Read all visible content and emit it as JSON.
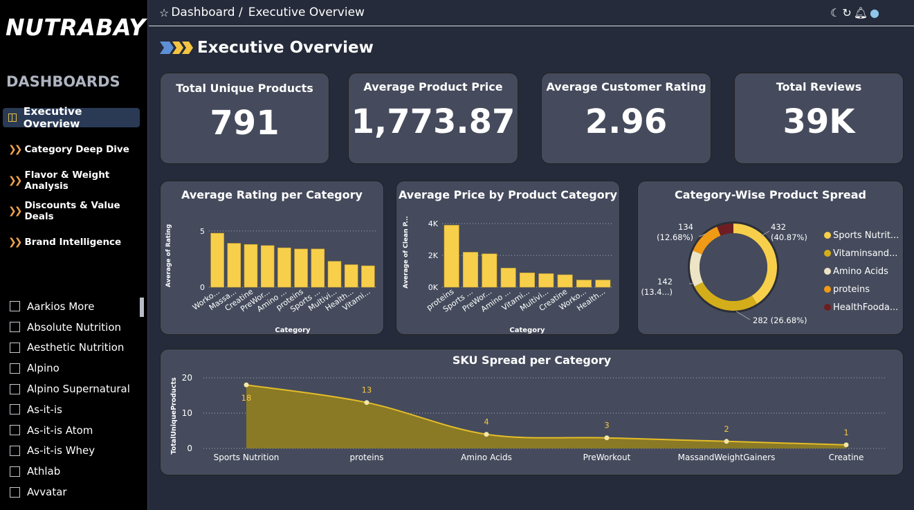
{
  "app": {
    "logo": "NUTRABAY"
  },
  "sidebar": {
    "heading": "DASHBOARDS",
    "nav": [
      {
        "label": "Executive Overview",
        "active": true
      },
      {
        "label": "Category Deep Dive"
      },
      {
        "label": "Flavor & Weight Analysis"
      },
      {
        "label": "Discounts & Value Deals"
      },
      {
        "label": "Brand Intelligence"
      }
    ],
    "brands": [
      "Aarkios More",
      "Absolute Nutrition",
      "Aesthetic Nutrition",
      "Alpino",
      "Alpino Supernatural",
      "As-it-is",
      "As-it-is Atom",
      "As-it-is Whey",
      "Athlab",
      "Avvatar"
    ]
  },
  "header": {
    "breadcrumb_root": "Dashboard /",
    "breadcrumb_current": "Executive Overview",
    "icons": [
      "moon-icon",
      "refresh-icon",
      "bell-icon",
      "globe-icon"
    ]
  },
  "page": {
    "title": "Executive Overview"
  },
  "kpis": [
    {
      "label": "Total Unique Products",
      "value": "791"
    },
    {
      "label": "Average Product Price",
      "value": "1,773.87"
    },
    {
      "label": "Average Customer Rating",
      "value": "2.96"
    },
    {
      "label": "Total Reviews",
      "value": "39K"
    }
  ],
  "colors": {
    "accent": "#f5c542",
    "panel": "#454b5c",
    "background": "#252b3a"
  },
  "chart_data": [
    {
      "type": "bar",
      "title": "Average Rating per Category",
      "xlabel": "Category",
      "ylabel": "Average of Rating",
      "categories": [
        "Worko...",
        "Massa...",
        "Creatine",
        "PreWor...",
        "Amino ...",
        "proteins",
        "Sports ...",
        "Multivi...",
        "Health...",
        "Vitami..."
      ],
      "values": [
        4.8,
        3.9,
        3.8,
        3.7,
        3.5,
        3.4,
        3.4,
        2.3,
        2.0,
        1.9
      ],
      "yticks": [
        "5",
        "0"
      ],
      "ylim": [
        0,
        5.6
      ]
    },
    {
      "type": "bar",
      "title": "Average Price by Product Category",
      "xlabel": "Category",
      "ylabel": "Average of Clean P...",
      "categories": [
        "proteins",
        "Sports ...",
        "PreWor...",
        "Amino ...",
        "Vitami...",
        "Multivi...",
        "Creatine",
        "Worko...",
        "Health..."
      ],
      "values": [
        3900,
        2200,
        2100,
        1200,
        900,
        850,
        780,
        450,
        450
      ],
      "yticks": [
        "4K",
        "2K",
        "0K"
      ],
      "ylim": [
        0,
        4400
      ]
    },
    {
      "type": "pie",
      "title": "Category-Wise Product Spread",
      "categories": [
        "Sports Nutrit...",
        "Vitaminsand...",
        "Amino Acids",
        "proteins",
        "HealthFooda..."
      ],
      "values": [
        432,
        282,
        142,
        134,
        65
      ],
      "labels": [
        {
          "count": "432",
          "pct": "(40.87%)"
        },
        {
          "count": "282 (26.68%)",
          "pct": ""
        },
        {
          "count": "142",
          "pct": "(13.4...)"
        },
        {
          "count": "134",
          "pct": "(12.68%)"
        }
      ],
      "colors": [
        "#f7cf4a",
        "#d4ad1a",
        "#ede4c6",
        "#f09a16",
        "#6e1e22"
      ]
    },
    {
      "type": "area",
      "title": "SKU Spread per Category",
      "ylabel": "TotalUniqueProducts",
      "categories": [
        "Sports Nutrition",
        "proteins",
        "Amino Acids",
        "PreWorkout",
        "MassandWeightGainers",
        "Creatine"
      ],
      "values": [
        18,
        13,
        4,
        3,
        2,
        1
      ],
      "yticks": [
        "20",
        "10",
        "0"
      ],
      "ylim": [
        0,
        20
      ]
    }
  ]
}
